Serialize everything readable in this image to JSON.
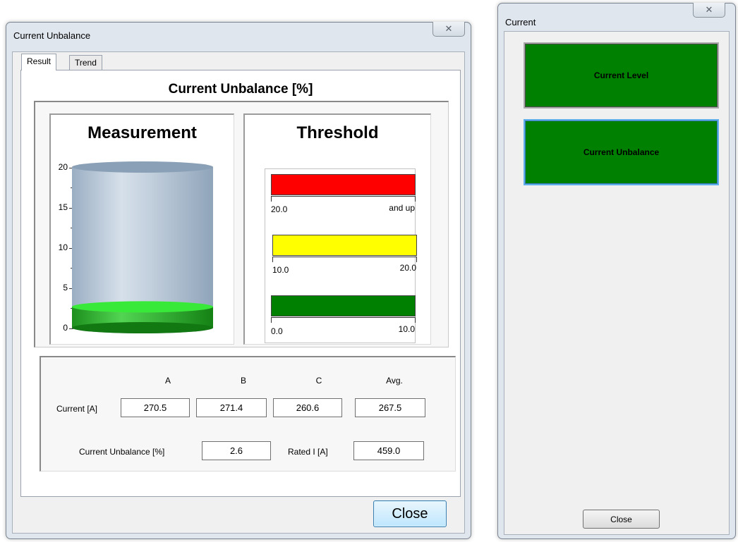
{
  "main_window": {
    "title": "Current Unbalance",
    "close_glyph": "✕",
    "tabs": [
      {
        "label": "Result"
      },
      {
        "label": "Trend"
      }
    ],
    "active_tab": "Result",
    "panel_title": "Current Unbalance [%]",
    "measurement": {
      "title": "Measurement",
      "axis_ticks": [
        "20",
        "15",
        "10",
        "5",
        "0"
      ],
      "axis_range": [
        0,
        20
      ],
      "level_value": 2.6,
      "fill_color": "#1fb51f"
    },
    "threshold": {
      "title": "Threshold",
      "bands": [
        {
          "color": "#ff0000",
          "low_label": "20.0",
          "high_label": "and up"
        },
        {
          "color": "#ffff00",
          "low_label": "10.0",
          "high_label": "20.0"
        },
        {
          "color": "#008000",
          "low_label": "0.0",
          "high_label": "10.0"
        }
      ]
    },
    "values": {
      "columns": [
        "A",
        "B",
        "C",
        "Avg."
      ],
      "current_label": "Current [A]",
      "current": [
        "270.5",
        "271.4",
        "260.6",
        "267.5"
      ],
      "unbalance_label": "Current Unbalance [%]",
      "unbalance": "2.6",
      "rated_label": "Rated I [A]",
      "rated": "459.0"
    },
    "close_label": "Close"
  },
  "side_window": {
    "title": "Current",
    "close_glyph": "✕",
    "buttons": [
      {
        "label": "Current Level"
      },
      {
        "label": "Current Unbalance"
      }
    ],
    "button_color": "#008000",
    "close_label": "Close"
  }
}
